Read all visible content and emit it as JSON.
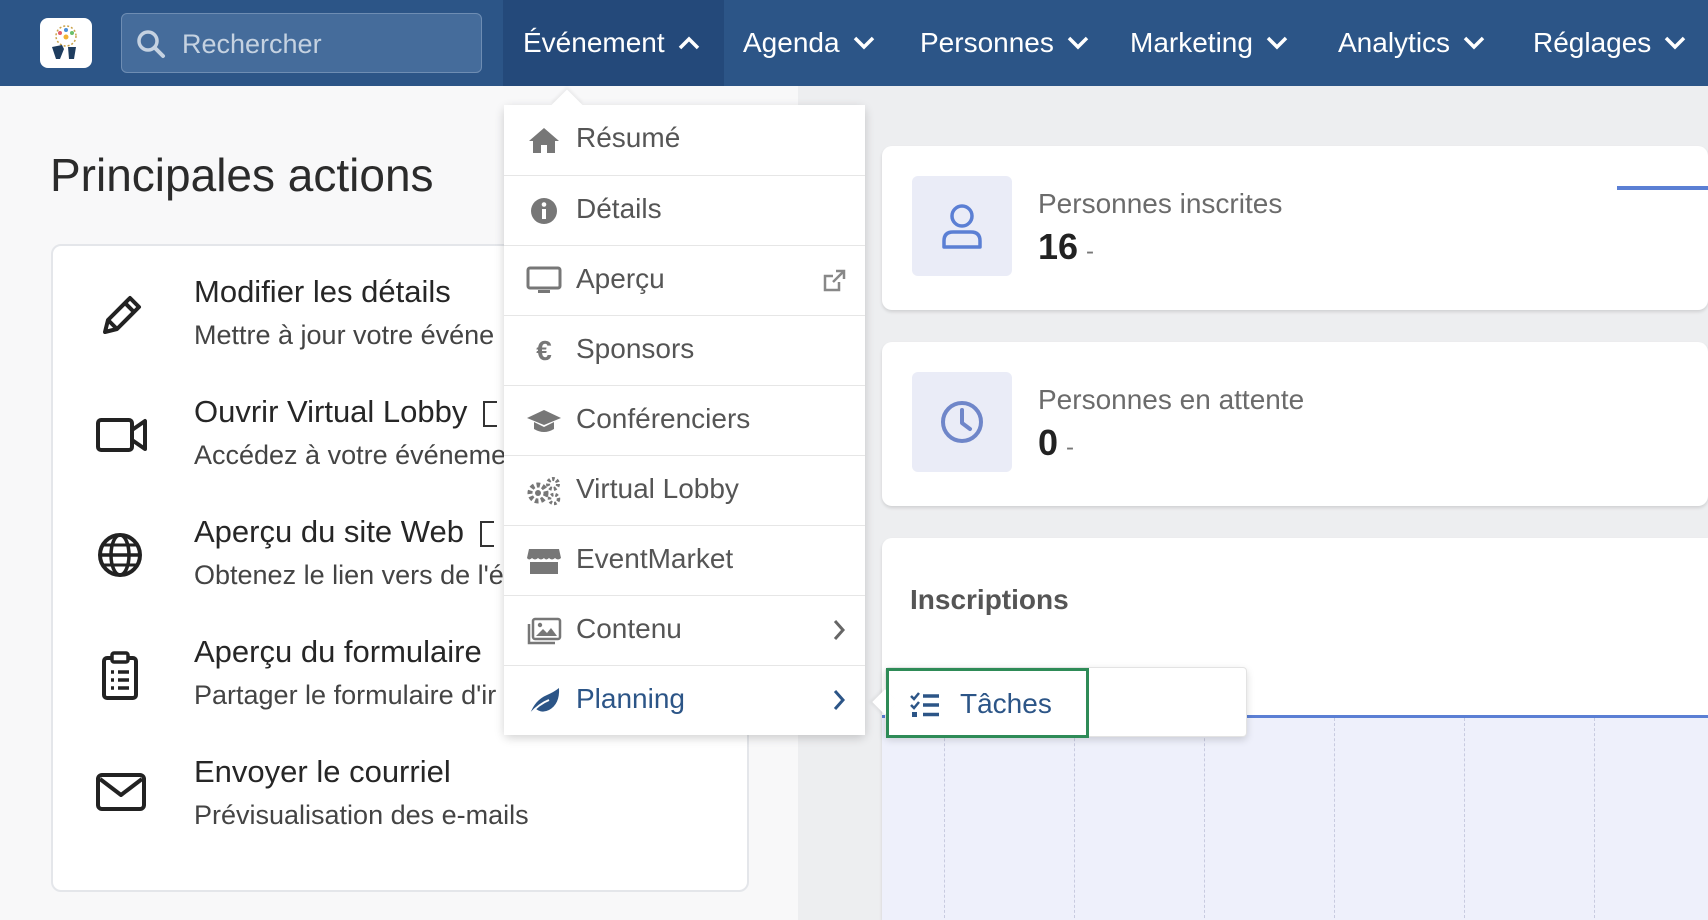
{
  "search": {
    "placeholder": "Rechercher"
  },
  "nav": [
    {
      "label": "Événement"
    },
    {
      "label": "Agenda"
    },
    {
      "label": "Personnes"
    },
    {
      "label": "Marketing"
    },
    {
      "label": "Analytics"
    },
    {
      "label": "Réglages"
    }
  ],
  "main_actions": {
    "title": "Principales actions",
    "items": [
      {
        "title": "Modifier les détails",
        "subtitle": "Mettre à jour votre événe",
        "icon": "pencil-icon"
      },
      {
        "title": "Ouvrir Virtual Lobby",
        "subtitle": "Accédez à votre événeme",
        "icon": "video-camera-icon"
      },
      {
        "title": "Aperçu du site Web",
        "subtitle": "Obtenez le lien vers de l'é",
        "icon": "globe-icon"
      },
      {
        "title": "Aperçu du formulaire",
        "subtitle": "Partager le formulaire d'ir",
        "icon": "clipboard-icon"
      },
      {
        "title": "Envoyer le courriel",
        "subtitle": "Prévisualisation des e-mails",
        "icon": "envelope-icon"
      }
    ]
  },
  "event_menu": {
    "items": [
      {
        "label": "Résumé",
        "icon": "home-icon"
      },
      {
        "label": "Détails",
        "icon": "info-icon"
      },
      {
        "label": "Aperçu",
        "icon": "monitor-icon",
        "external": true
      },
      {
        "label": "Sponsors",
        "icon": "euro-icon"
      },
      {
        "label": "Conférenciers",
        "icon": "graduation-cap-icon"
      },
      {
        "label": "Virtual Lobby",
        "icon": "gears-icon"
      },
      {
        "label": "EventMarket",
        "icon": "store-icon"
      },
      {
        "label": "Contenu",
        "icon": "images-icon",
        "submenu": true
      },
      {
        "label": "Planning",
        "icon": "leaf-icon",
        "submenu": true,
        "highlighted": true
      }
    ]
  },
  "planning_submenu": {
    "items": [
      {
        "label": "Tâches",
        "icon": "task-list-icon"
      }
    ]
  },
  "stats": {
    "registered": {
      "label": "Personnes inscrites",
      "value": "16",
      "suffix": "-"
    },
    "waiting": {
      "label": "Personnes en attente",
      "value": "0",
      "suffix": "-"
    }
  },
  "chart": {
    "title": "Inscriptions"
  },
  "colors": {
    "topbar": "#2c5587",
    "accent": "#5b7fd4",
    "submenu_focus": "#2e8b57"
  }
}
